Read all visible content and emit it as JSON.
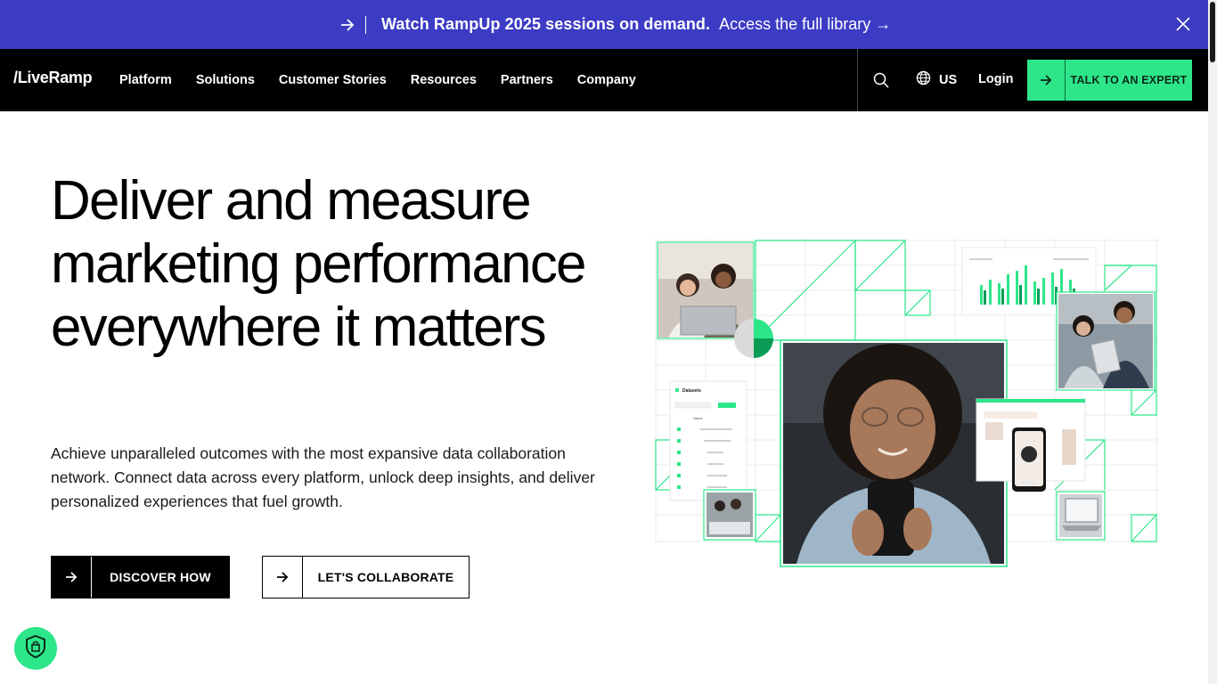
{
  "banner": {
    "headline": "Watch RampUp 2025 sessions on demand.",
    "link_label": "Access the full library →",
    "background": "#3c3bc4"
  },
  "nav": {
    "logo": "/LiveRamp",
    "items": [
      {
        "label": "Platform"
      },
      {
        "label": "Solutions"
      },
      {
        "label": "Customer Stories"
      },
      {
        "label": "Resources"
      },
      {
        "label": "Partners"
      },
      {
        "label": "Company"
      }
    ],
    "region": "US",
    "login": "Login",
    "cta_label": "TALK TO AN EXPERT",
    "accent": "#2ee68a"
  },
  "hero": {
    "title": "Deliver and measure marketing performance everywhere it matters",
    "description": "Achieve unparalleled outcomes with the most expansive data collaboration network. Connect data across every platform, unlock deep insights, and deliver personalized experiences that fuel growth.",
    "primary_button": "DISCOVER HOW",
    "secondary_button": "LET'S COLLABORATE"
  },
  "illustration": {
    "panel_title": "Datasets",
    "panel_row": "Name"
  },
  "icons": {
    "banner_arrow": "arrow-right-icon",
    "close": "close-icon",
    "search": "search-icon",
    "globe": "globe-icon",
    "privacy": "shield-lock-icon"
  }
}
